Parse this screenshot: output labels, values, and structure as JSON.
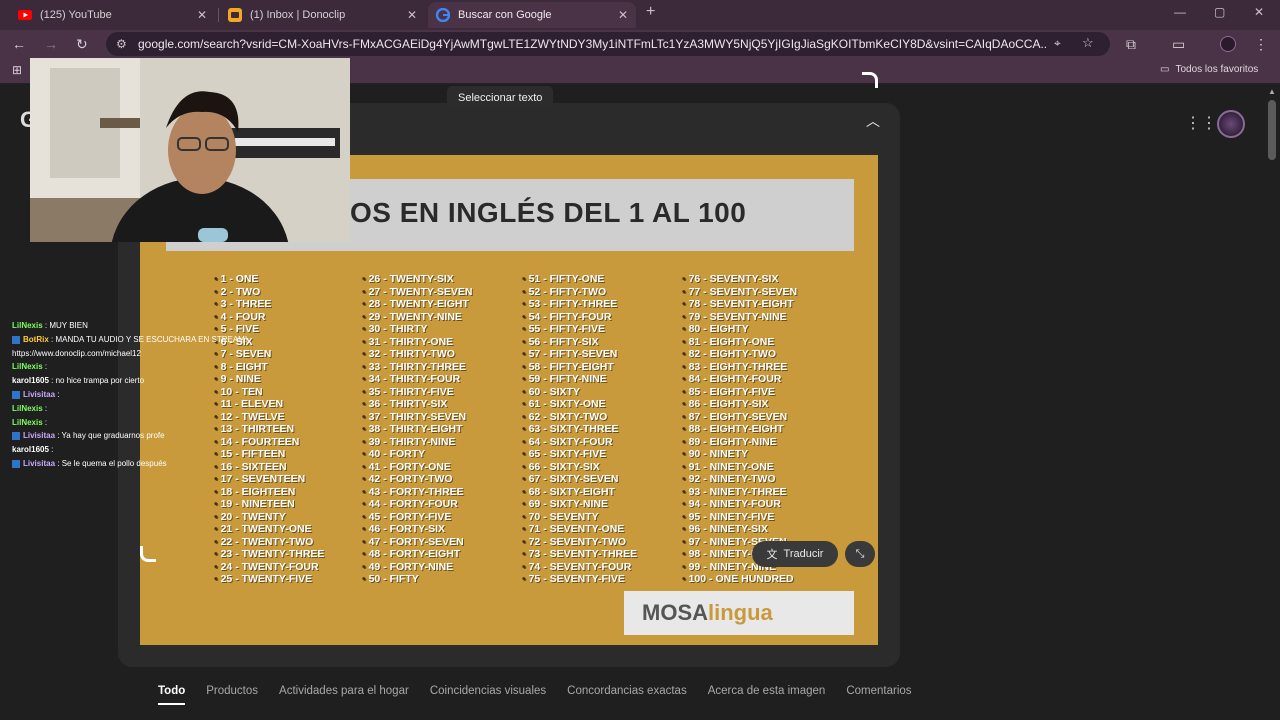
{
  "browser": {
    "tabs": [
      {
        "title": "(125) YouTube",
        "icon": "youtube-icon",
        "active": false
      },
      {
        "title": "(1) Inbox | Donoclip",
        "icon": "donoclip-icon",
        "active": false
      },
      {
        "title": "Buscar con Google",
        "icon": "google-icon",
        "active": true
      }
    ],
    "url": "google.com/search?vsrid=CM-XoaHVrs-FMxACGAEiDg4YjAwMTgwLTE1ZWYtNDY3My1iNTFmLTc1YzA3MWY5NjQ5YjIGIgJiaSgKOITbmKeCIY8D&vsint=CAIqDAoCCA...",
    "bookmarks_all": "Todos los favoritos"
  },
  "lens": {
    "select_text_label": "Seleccionar texto",
    "translate_label": "Traducir",
    "poster": {
      "title": "OS EN INGLÉS DEL 1 AL 100",
      "logo_part1": "MOSA",
      "logo_part2": "lingua",
      "columns": [
        [
          "1 - ONE",
          "2 - TWO",
          "3 - THREE",
          "4 - FOUR",
          "5 - FIVE",
          "6 - SIX",
          "7 - SEVEN",
          "8 - EIGHT",
          "9 - NINE",
          "10 - TEN",
          "11 - ELEVEN",
          "12 - TWELVE",
          "13 - THIRTEEN",
          "14 - FOURTEEN",
          "15 - FIFTEEN",
          "16 - SIXTEEN",
          "17 - SEVENTEEN",
          "18 - EIGHTEEN",
          "19 - NINETEEN",
          "20 - TWENTY",
          "21 - TWENTY-ONE",
          "22 - TWENTY-TWO",
          "23 - TWENTY-THREE",
          "24 - TWENTY-FOUR",
          "25 - TWENTY-FIVE"
        ],
        [
          "26 - TWENTY-SIX",
          "27 - TWENTY-SEVEN",
          "28 - TWENTY-EIGHT",
          "29 - TWENTY-NINE",
          "30 - THIRTY",
          "31 - THIRTY-ONE",
          "32 - THIRTY-TWO",
          "33 - THIRTY-THREE",
          "34 - THIRTY-FOUR",
          "35 - THIRTY-FIVE",
          "36 - THIRTY-SIX",
          "37 - THIRTY-SEVEN",
          "38 - THIRTY-EIGHT",
          "39 - THIRTY-NINE",
          "40 - FORTY",
          "41 - FORTY-ONE",
          "42 - FORTY-TWO",
          "43 - FORTY-THREE",
          "44 - FORTY-FOUR",
          "45 - FORTY-FIVE",
          "46 - FORTY-SIX",
          "47 - FORTY-SEVEN",
          "48 - FORTY-EIGHT",
          "49 - FORTY-NINE",
          "50 - FIFTY"
        ],
        [
          "51 - FIFTY-ONE",
          "52 - FIFTY-TWO",
          "53 - FIFTY-THREE",
          "54 - FIFTY-FOUR",
          "55 - FIFTY-FIVE",
          "56 - FIFTY-SIX",
          "57 - FIFTY-SEVEN",
          "58 - FIFTY-EIGHT",
          "59 - FIFTY-NINE",
          "60 - SIXTY",
          "61 - SIXTY-ONE",
          "62 - SIXTY-TWO",
          "63 - SIXTY-THREE",
          "64 - SIXTY-FOUR",
          "65 - SIXTY-FIVE",
          "66 - SIXTY-SIX",
          "67 - SIXTY-SEVEN",
          "68 - SIXTY-EIGHT",
          "69 - SIXTY-NINE",
          "70 - SEVENTY",
          "71 - SEVENTY-ONE",
          "72 - SEVENTY-TWO",
          "73 - SEVENTY-THREE",
          "74 - SEVENTY-FOUR",
          "75 - SEVENTY-FIVE"
        ],
        [
          "76 - SEVENTY-SIX",
          "77 - SEVENTY-SEVEN",
          "78 - SEVENTY-EIGHT",
          "79 - SEVENTY-NINE",
          "80 - EIGHTY",
          "81 - EIGHTY-ONE",
          "82 - EIGHTY-TWO",
          "83 - EIGHTY-THREE",
          "84 - EIGHTY-FOUR",
          "85 - EIGHTY-FIVE",
          "86 - EIGHTY-SIX",
          "87 - EIGHTY-SEVEN",
          "88 - EIGHTY-EIGHT",
          "89 - EIGHTY-NINE",
          "90 - NINETY",
          "91 - NINETY-ONE",
          "92 - NINETY-TWO",
          "93 - NINETY-THREE",
          "94 - NINETY-FOUR",
          "95 - NINETY-FIVE",
          "96 - NINETY-SIX",
          "97 - NINETY-SEVEN",
          "98 - NINETY-EIGHT",
          "99 - NINETY-NINE",
          "100 - ONE HUNDRED"
        ]
      ]
    }
  },
  "result_tabs": [
    "Todo",
    "Productos",
    "Actividades para el hogar",
    "Coincidencias visuales",
    "Concordancias exactas",
    "Acerca de esta imagen",
    "Comentarios"
  ],
  "chat": [
    {
      "user": "LilNexis",
      "color": "#7cff5e",
      "text": ": MUY BIEN",
      "badge": false
    },
    {
      "user": "BotRix",
      "color": "#ffcc33",
      "text": ": MANDA TU AUDIO Y SE ESCUCHARA EN STREAM!",
      "badge": true
    },
    {
      "user": "",
      "color": "#ffffff",
      "text": "https://www.donoclip.com/michael12",
      "badge": false
    },
    {
      "user": "LilNexis",
      "color": "#7cff5e",
      "text": ":",
      "badge": false
    },
    {
      "user": "karol1605",
      "color": "#ffffff",
      "text": ": no hice trampa por cierto",
      "badge": false
    },
    {
      "user": "Livisitaa",
      "color": "#c9a8ff",
      "text": ":",
      "badge": true
    },
    {
      "user": "LilNexis",
      "color": "#7cff5e",
      "text": ":",
      "badge": false
    },
    {
      "user": "LilNexis",
      "color": "#7cff5e",
      "text": ":",
      "badge": false
    },
    {
      "user": "Livisitaa",
      "color": "#c9a8ff",
      "text": ": Ya hay que graduarnos profe",
      "badge": true
    },
    {
      "user": "karol1605",
      "color": "#ffffff",
      "text": ":",
      "badge": false
    },
    {
      "user": "Livisitaa",
      "color": "#c9a8ff",
      "text": ": Se le quema el pollo después",
      "badge": true
    }
  ]
}
